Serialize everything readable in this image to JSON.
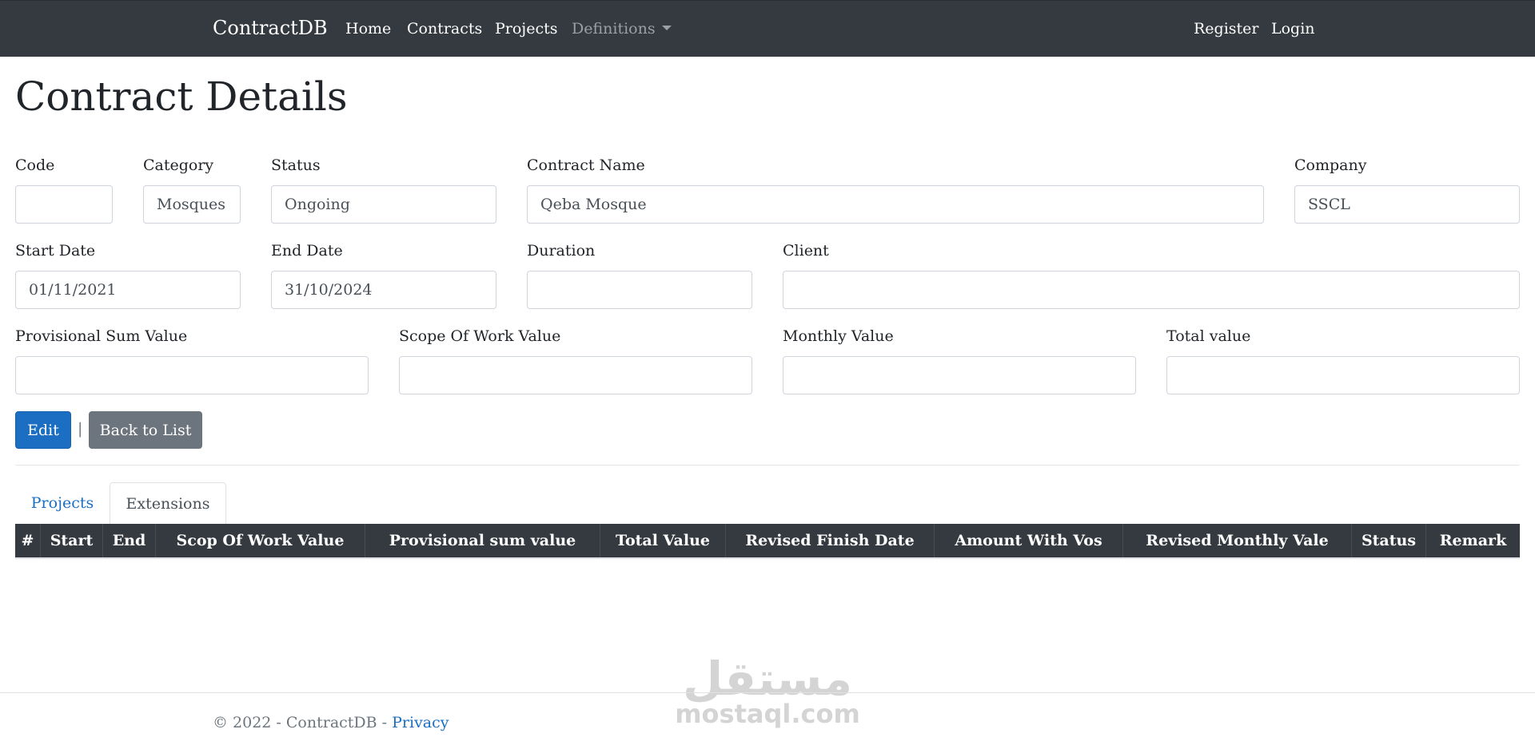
{
  "navbar": {
    "brand": "ContractDB",
    "links": [
      "Home",
      "Contracts",
      "Projects"
    ],
    "dropdown": "Definitions",
    "right_links": [
      "Register",
      "Login"
    ]
  },
  "page": {
    "title": "Contract Details"
  },
  "form": {
    "code": {
      "label": "Code",
      "value": ""
    },
    "category": {
      "label": "Category",
      "value": "Mosques"
    },
    "status": {
      "label": "Status",
      "value": "Ongoing"
    },
    "contract_name": {
      "label": "Contract Name",
      "value": "Qeba Mosque"
    },
    "company": {
      "label": "Company",
      "value": "SSCL"
    },
    "start_date": {
      "label": "Start Date",
      "value": "01/11/2021"
    },
    "end_date": {
      "label": "End Date",
      "value": "31/10/2024"
    },
    "duration": {
      "label": "Duration",
      "value": ""
    },
    "client": {
      "label": "Client",
      "value": ""
    },
    "provisional_sum": {
      "label": "Provisional Sum Value",
      "value": ""
    },
    "scope_of_work": {
      "label": "Scope Of Work Value",
      "value": ""
    },
    "monthly_value": {
      "label": "Monthly Value",
      "value": ""
    },
    "total_value": {
      "label": "Total value",
      "value": ""
    }
  },
  "actions": {
    "edit": "Edit",
    "separator": "|",
    "back": "Back to List"
  },
  "tabs": [
    "Projects",
    "Extensions"
  ],
  "table": {
    "headers": [
      "#",
      "Start",
      "End",
      "Scop Of Work Value",
      "Provisional sum value",
      "Total Value",
      "Revised Finish Date",
      "Amount With Vos",
      "Revised Monthly Vale",
      "Status",
      "Remark"
    ]
  },
  "footer": {
    "text": "© 2022 - ContractDB - ",
    "link": "Privacy"
  },
  "watermark": {
    "arabic": "مستقل",
    "latin": "mostaql.com"
  },
  "colors": {
    "navbar": "#343a40",
    "primary": "#1b6ec2",
    "secondary": "#6c757d"
  }
}
